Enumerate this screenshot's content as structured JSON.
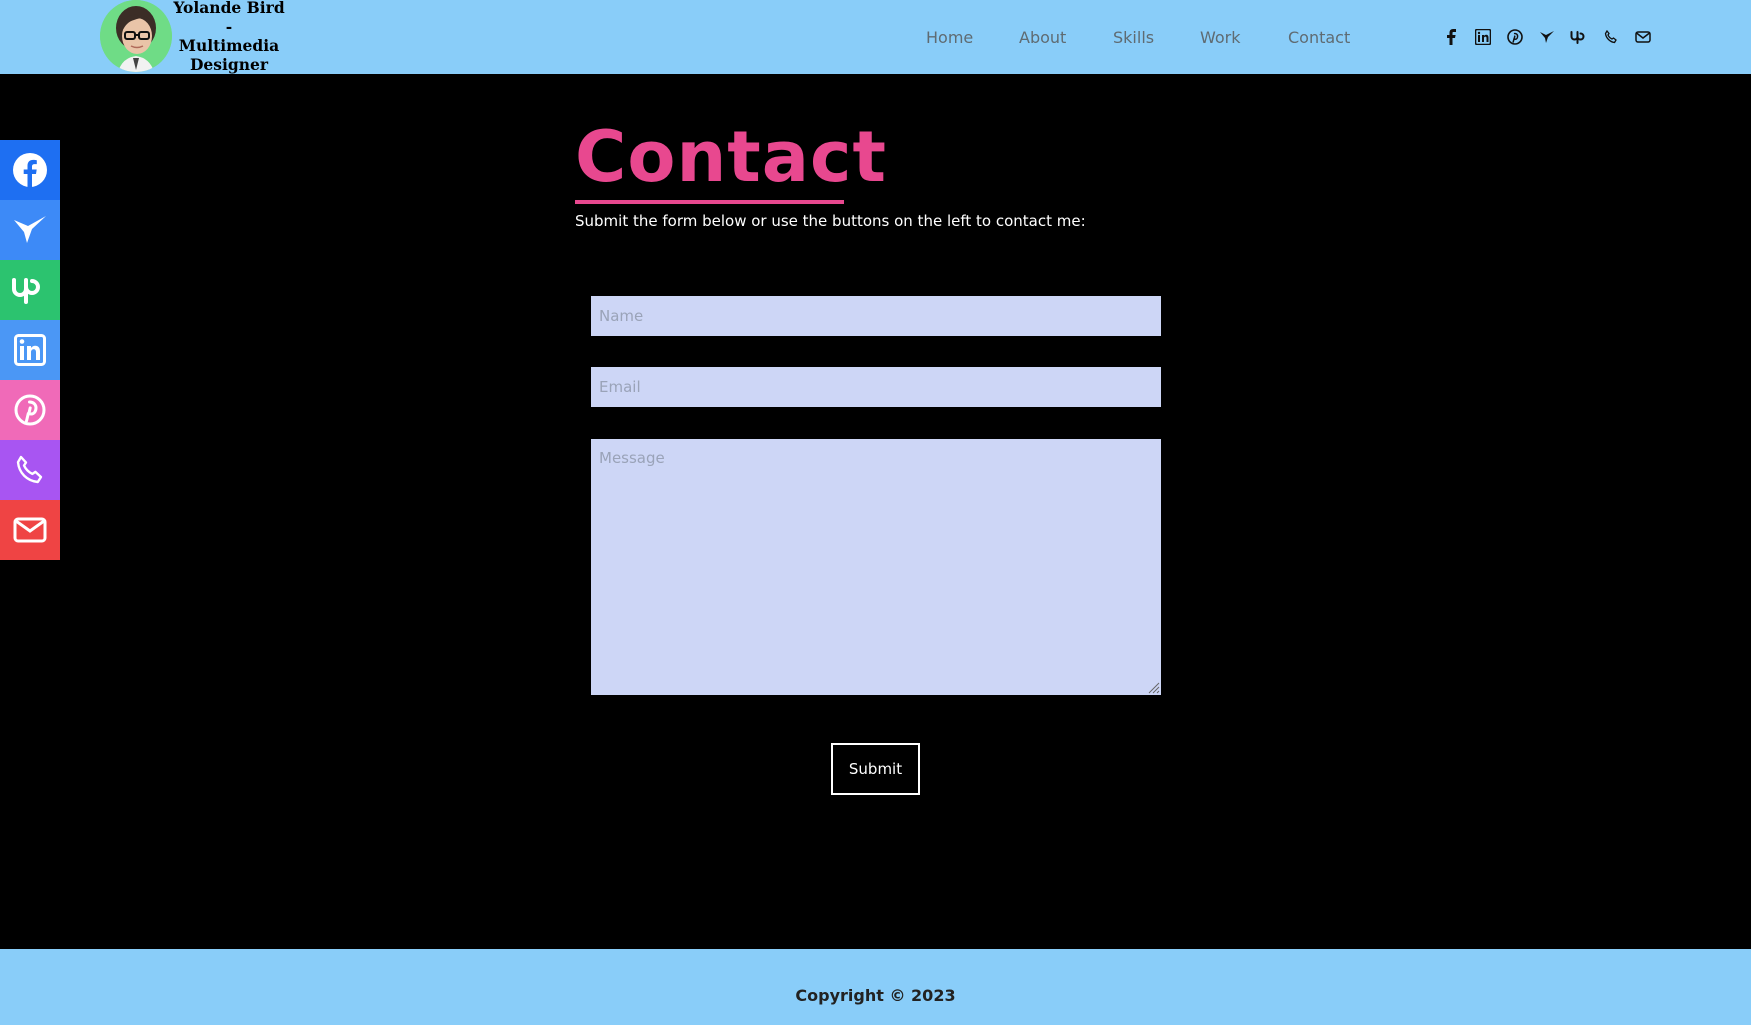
{
  "header": {
    "brand": "Yolande Bird\n-\nMultimedia\nDesigner",
    "nav": [
      {
        "label": "Home"
      },
      {
        "label": "About"
      },
      {
        "label": "Skills"
      },
      {
        "label": "Work"
      },
      {
        "label": "Contact"
      }
    ],
    "social": [
      {
        "icon": "facebook-icon"
      },
      {
        "icon": "linkedin-icon"
      },
      {
        "icon": "pinterest-icon"
      },
      {
        "icon": "hummingbird-icon"
      },
      {
        "icon": "upwork-icon"
      },
      {
        "icon": "phone-icon"
      },
      {
        "icon": "mail-icon"
      }
    ]
  },
  "sidebar": {
    "buttons": [
      {
        "icon": "facebook-icon",
        "color": "#1e6ff2"
      },
      {
        "icon": "hummingbird-icon",
        "color": "#3d8af7"
      },
      {
        "icon": "upwork-icon",
        "color": "#2cc36f"
      },
      {
        "icon": "linkedin-icon",
        "color": "#4b97f5"
      },
      {
        "icon": "pinterest-icon",
        "color": "#f06ab8"
      },
      {
        "icon": "phone-icon",
        "color": "#a855f2"
      },
      {
        "icon": "mail-icon",
        "color": "#ef4444"
      }
    ]
  },
  "main": {
    "title": "Contact",
    "subtitle": "Submit the form below or use the buttons on the left to contact me:",
    "form": {
      "name_placeholder": "Name",
      "email_placeholder": "Email",
      "message_placeholder": "Message",
      "submit_label": "Submit"
    }
  },
  "footer": {
    "copyright": "Copyright © 2023"
  },
  "colors": {
    "header_bg": "#89cdf9",
    "accent": "#e8488f",
    "field_bg": "#cdd6f6"
  }
}
